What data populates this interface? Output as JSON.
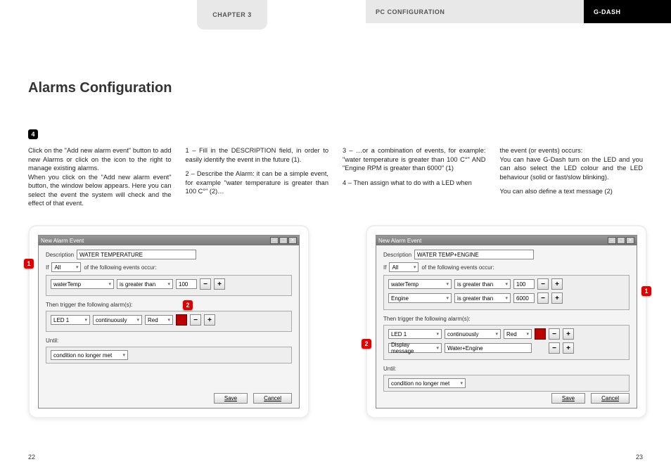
{
  "header": {
    "chapter": "CHAPTER 3",
    "section": "PC CONFIGURATION",
    "brand": "G-DASH"
  },
  "title": "Alarms Configuration",
  "step_number": "4",
  "columns": {
    "c1": "Click on the \"Add new alarm event\" button to add new Alarms or click on the icon to the right to manage existing alarms.\nWhen you click on the \"Add new alarm event\" button, the window below appears. Here you can select the event the system will check and the effect of that event.",
    "c2a": "1 – Fill in the DESCRIPTION field, in order to easily identify the event in the future (1).",
    "c2b": "2 – Describe the Alarm: it can be a simple event, for example \"water temperature is greater than 100 C°\" (2)…",
    "c3a": "3 – …or a combination of events, for example: \"water temperature is greater than 100 C°\" AND \"Engine RPM is greater than 6000\" (1)",
    "c3b": "4 – Then assign what to do with a LED when",
    "c4a": "the event (or events) occurs:",
    "c4b": "You can have G-Dash turn on the LED and you can also select the LED colour and the LED behaviour (solid or fast/slow blinking).",
    "c4c": "You can also define a text message (2)"
  },
  "dialog1": {
    "title": "New Alarm Event",
    "desc_label": "Description",
    "desc_value": "WATER TEMPERATURE",
    "if_label": "If",
    "if_scope": "All",
    "if_rest": "of the following events occur:",
    "events": [
      {
        "field": "waterTemp",
        "op": "is greater than",
        "value": "100"
      }
    ],
    "trigger_label": "Then trigger the following alarm(s):",
    "alarms": [
      {
        "led": "LED 1",
        "mode": "continuously",
        "color": "Red"
      }
    ],
    "until_label": "Until:",
    "until_value": "condition no longer met",
    "save": "Save",
    "cancel": "Cancel",
    "callout1": "1",
    "callout2": "2"
  },
  "dialog2": {
    "title": "New Alarm Event",
    "desc_label": "Description",
    "desc_value": "WATER TEMP+ENGINE",
    "if_label": "If",
    "if_scope": "All",
    "if_rest": "of the following events occur:",
    "events": [
      {
        "field": "waterTemp",
        "op": "is greater than",
        "value": "100"
      },
      {
        "field": "Engine",
        "op": "is greater than",
        "value": "6000"
      }
    ],
    "trigger_label": "Then trigger the following alarm(s):",
    "alarms": [
      {
        "led": "LED 1",
        "mode": "continuously",
        "color": "Red"
      },
      {
        "led": "Display message",
        "mode": "Water+Engine",
        "color": ""
      }
    ],
    "until_label": "Until:",
    "until_value": "condition no longer met",
    "save": "Save",
    "cancel": "Cancel",
    "callout1": "1",
    "callout2": "2"
  },
  "pages": {
    "left": "22",
    "right": "23"
  }
}
